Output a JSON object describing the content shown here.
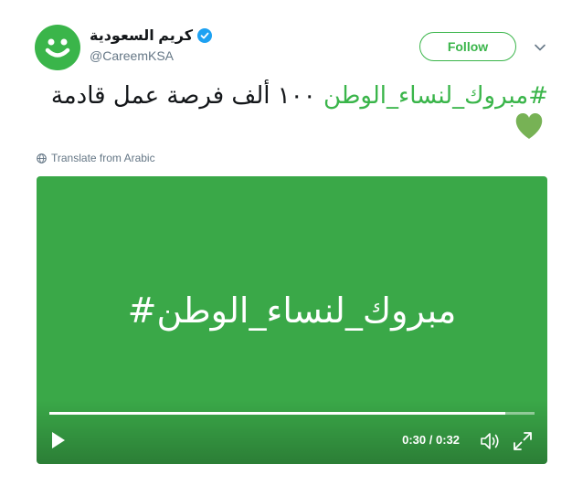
{
  "tweet": {
    "display_name": "كريم السعودية",
    "handle": "@CareemKSA",
    "follow_label": "Follow",
    "hashtag": "#مبروك_لنساء_الوطن",
    "text_rest": "١٠٠ ألف فرصة عمل قادمة",
    "translate_label": "Translate from Arabic"
  },
  "video": {
    "title": "#مبروك_لنساء_الوطن",
    "time": "0:30 / 0:32",
    "progress": 0.94,
    "background": "#3aa848"
  },
  "colors": {
    "brand": "#3ab54a",
    "verified": "#1da1f2"
  },
  "icons": [
    "careem-logo-icon",
    "verified-icon",
    "chevron-down-icon",
    "green-heart-icon",
    "globe-icon",
    "play-icon",
    "volume-icon",
    "fullscreen-icon"
  ]
}
